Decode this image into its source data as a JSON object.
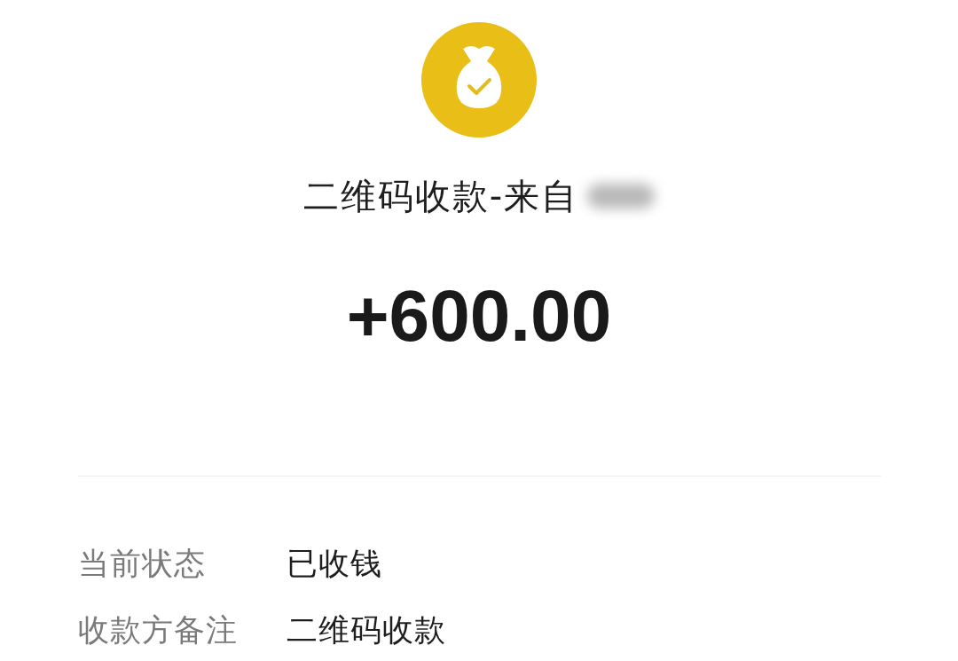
{
  "transaction": {
    "title": "二维码收款-来自",
    "amount": "+600.00"
  },
  "details": [
    {
      "label": "当前状态",
      "value": "已收钱"
    },
    {
      "label": "收款方备注",
      "value": "二维码收款"
    }
  ]
}
